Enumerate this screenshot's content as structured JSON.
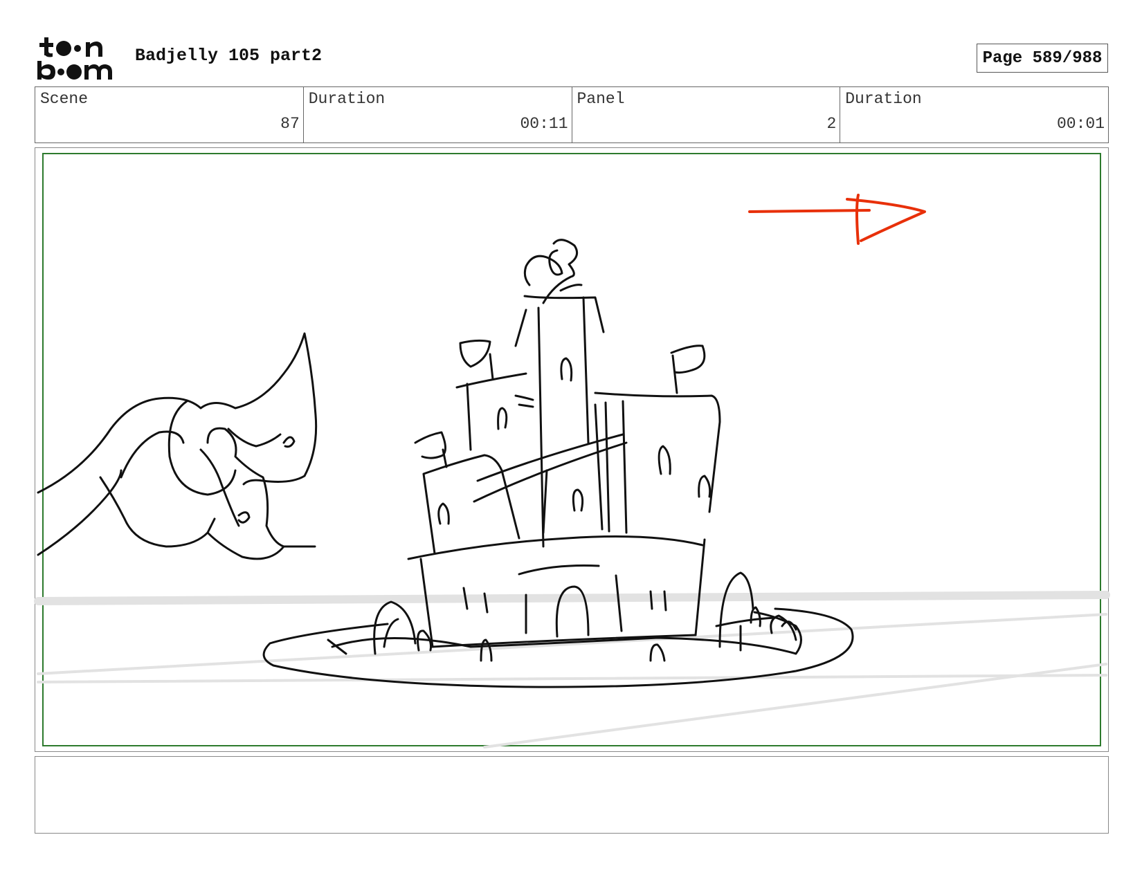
{
  "header": {
    "logo_text": "toon boom",
    "title": "Badjelly 105 part2",
    "page_label": "Page 589/988"
  },
  "info": {
    "scene_label": "Scene",
    "scene_value": "87",
    "scene_duration_label": "Duration",
    "scene_duration_value": "00:11",
    "panel_label": "Panel",
    "panel_value": "2",
    "panel_duration_label": "Duration",
    "panel_duration_value": "00:01"
  },
  "colors": {
    "frame_border": "#2d7a2d",
    "direction_arrow": "#e8300a",
    "sketch_line": "#111111",
    "guide_line": "#e2e2e2"
  },
  "notes": {
    "text": ""
  }
}
